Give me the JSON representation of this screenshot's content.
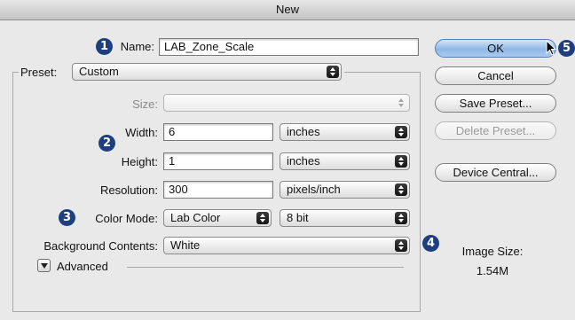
{
  "window": {
    "title": "New"
  },
  "form": {
    "name": {
      "label": "Name:",
      "value": "LAB_Zone_Scale"
    },
    "preset": {
      "label": "Preset:",
      "value": "Custom"
    },
    "size": {
      "label": "Size:",
      "value": ""
    },
    "width": {
      "label": "Width:",
      "value": "6",
      "unit": "inches"
    },
    "height": {
      "label": "Height:",
      "value": "1",
      "unit": "inches"
    },
    "resolution": {
      "label": "Resolution:",
      "value": "300",
      "unit": "pixels/inch"
    },
    "color_mode": {
      "label": "Color Mode:",
      "value": "Lab Color",
      "depth": "8 bit"
    },
    "background": {
      "label": "Background Contents:",
      "value": "White"
    },
    "advanced": {
      "label": "Advanced"
    }
  },
  "buttons": {
    "ok": "OK",
    "cancel": "Cancel",
    "save_preset": "Save Preset...",
    "delete_preset": "Delete Preset...",
    "device_central": "Device Central..."
  },
  "image_size": {
    "label": "Image Size:",
    "value": "1.54M"
  },
  "callouts": [
    "1",
    "2",
    "3",
    "4",
    "5"
  ],
  "colors": {
    "callout": "#1e3f7e",
    "default_button": "#8fb8e6"
  },
  "icons": [
    "stepper-arrows-icon",
    "disclosure-triangle-icon",
    "mouse-pointer-icon"
  ]
}
